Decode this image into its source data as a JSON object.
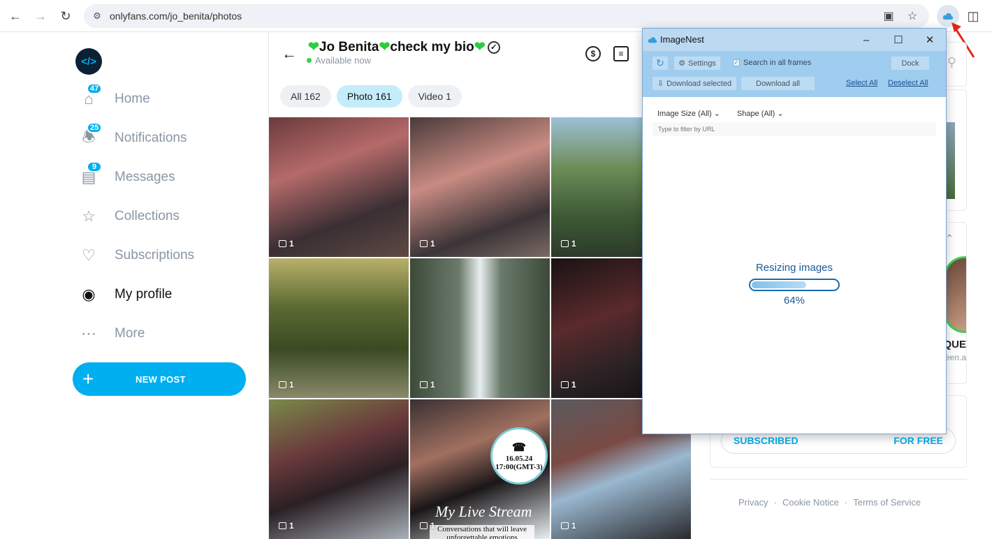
{
  "browser": {
    "url": "onlyfans.com/jo_benita/photos"
  },
  "sidebar": {
    "logo_text": "</>",
    "items": [
      {
        "label": "Home",
        "badge": "47",
        "icon": "home-icon"
      },
      {
        "label": "Notifications",
        "badge": "25",
        "icon": "bell-icon"
      },
      {
        "label": "Messages",
        "badge": "9",
        "icon": "chat-icon"
      },
      {
        "label": "Collections",
        "badge": "",
        "icon": "bookmark-icon"
      },
      {
        "label": "Subscriptions",
        "badge": "",
        "icon": "user-heart-icon"
      },
      {
        "label": "My profile",
        "badge": "",
        "icon": "profile-icon",
        "active": true
      },
      {
        "label": "More",
        "badge": "",
        "icon": "more-icon"
      }
    ],
    "new_post": "NEW POST"
  },
  "profile": {
    "name_part1": "Jo Benita",
    "name_part2": "check my bio",
    "status": "Available now",
    "tip_icon": "$"
  },
  "tabs": [
    {
      "label": "All 162"
    },
    {
      "label": "Photo 161",
      "active": true
    },
    {
      "label": "Video 1"
    }
  ],
  "grid": {
    "counts": [
      "1",
      "1",
      "1",
      "1",
      "1",
      "1",
      "1",
      "1",
      "1"
    ],
    "stream_date": "16.05.24",
    "stream_time": "17:00(GMT-3)",
    "stream_title": "My Live Stream",
    "stream_caption": "Conversations that will leave unforgettable emotions"
  },
  "right": {
    "card_name": "QUE",
    "card_handle": "een.a",
    "subscribe_label": "SUBSCRIBED",
    "subscribe_price": "FOR FREE",
    "footer_links": [
      "Privacy",
      "Cookie Notice",
      "Terms of Service"
    ]
  },
  "imagenest": {
    "title": "ImageNest",
    "settings": "Settings",
    "search_all_frames": "Search in all frames",
    "dock": "Dock",
    "download_selected": "Download selected",
    "download_all": "Download all",
    "select_all": "Select All",
    "deselect_all": "Deselect All",
    "image_size": "Image Size (All)",
    "shape": "Shape (All)",
    "url_placeholder": "Type to filter by URL",
    "status": "Resizing images",
    "progress": 0.64,
    "progress_text": "64%"
  },
  "colors": {
    "accent": "#00aff0",
    "online": "#3ccf4e",
    "arrow": "#e0251b"
  }
}
